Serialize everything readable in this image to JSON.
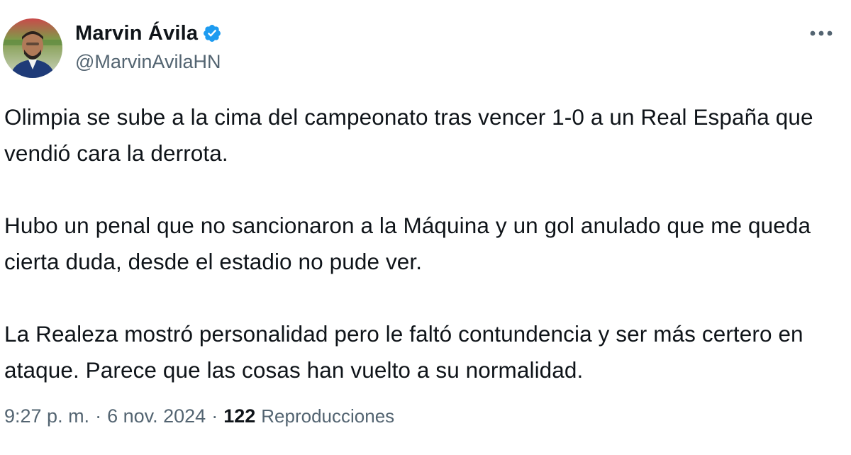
{
  "author": {
    "display_name": "Marvin Ávila",
    "handle": "@MarvinAvilaHN",
    "verified": true,
    "verified_color": "#1d9bf0"
  },
  "tweet": {
    "paragraphs": [
      "Olimpia se sube a la cima del campeonato tras vencer 1-0 a un Real España que vendió cara la derrota.",
      "Hubo un penal que no sancionaron a la Máquina y un gol anulado que me queda cierta duda, desde el estadio no pude ver.",
      "La Realeza mostró personalidad pero le faltó contundencia y ser más certero en ataque. Parece que las cosas han vuelto a su normalidad."
    ]
  },
  "meta": {
    "time": "9:27 p. m.",
    "separator": "·",
    "date": "6 nov. 2024",
    "views_count": "122",
    "views_label": "Reproducciones"
  },
  "icons": {
    "more": "more-horizontal-icon",
    "verified": "verified-badge-icon",
    "avatar": "profile-avatar"
  },
  "colors": {
    "text_primary": "#0f1419",
    "text_secondary": "#536471"
  }
}
